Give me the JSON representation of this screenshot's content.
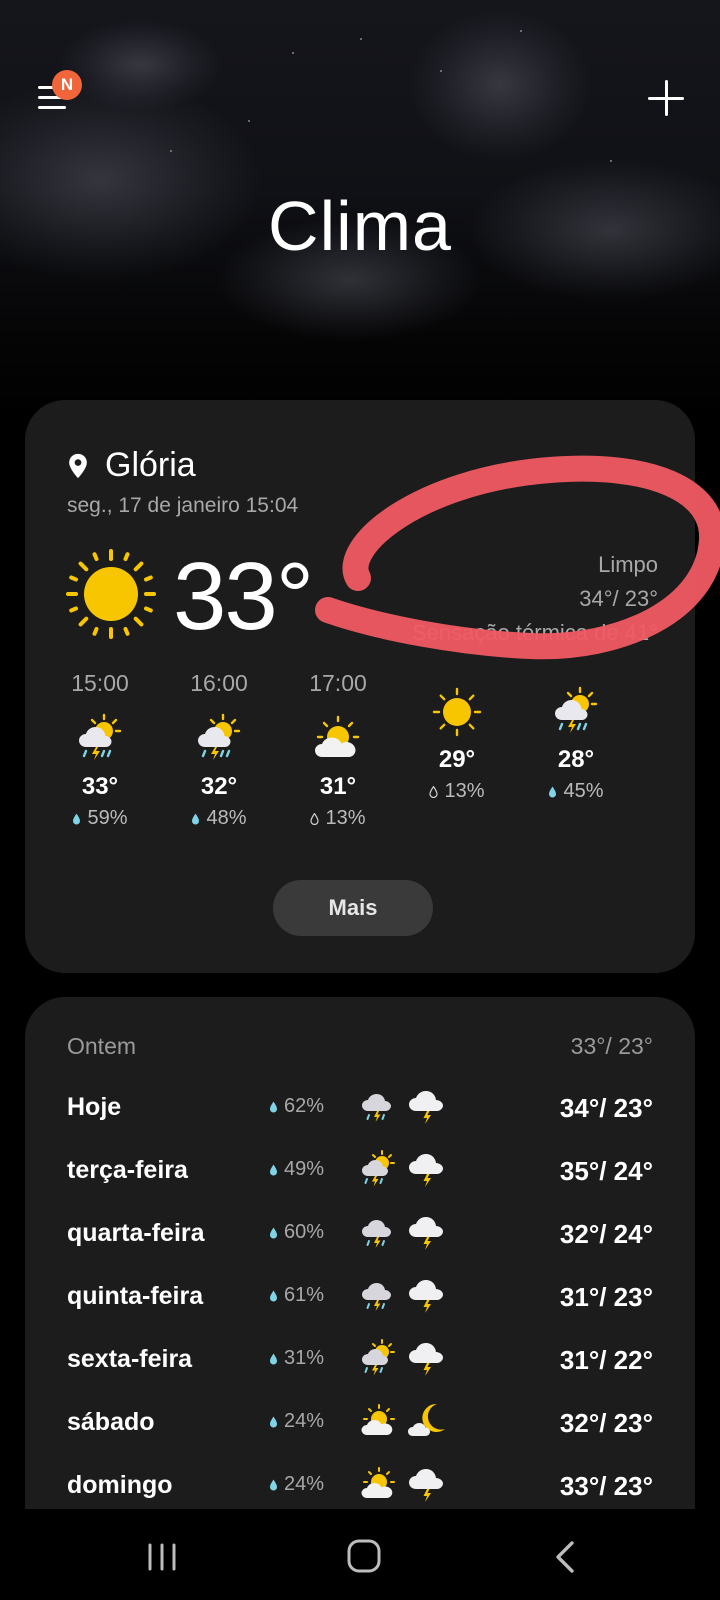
{
  "header": {
    "title": "Clima",
    "menu_badge": "N"
  },
  "current": {
    "location": "Glória",
    "datetime": "seg., 17 de janeiro 15:04",
    "temperature": "33°",
    "condition": "Limpo",
    "high_low": "34°/ 23°",
    "feels_like": "Sensação térmica de 41°",
    "icon": "sun-icon",
    "more_label": "Mais"
  },
  "hourly": [
    {
      "time": "15:00",
      "temp": "33°",
      "rain": "59%",
      "icon": "sun-thunder-rain-icon"
    },
    {
      "time": "16:00",
      "temp": "32°",
      "rain": "48%",
      "icon": "sun-thunder-rain-icon"
    },
    {
      "time": "17:00",
      "temp": "31°",
      "rain": "13%",
      "icon": "partly-cloudy-icon"
    },
    {
      "time": "",
      "temp": "29°",
      "rain": "13%",
      "icon": "sun-icon"
    },
    {
      "time": "",
      "temp": "28°",
      "rain": "45%",
      "icon": "sun-thunder-rain-icon"
    }
  ],
  "forecast": {
    "yesterday_label": "Ontem",
    "yesterday_temps": "33°/ 23°",
    "days": [
      {
        "day": "Hoje",
        "rain": "62%",
        "temps": "34°/ 23°",
        "icon_day": "cloud-thunder-rain-icon",
        "icon_night": "cloud-thunder-icon"
      },
      {
        "day": "terça-feira",
        "rain": "49%",
        "temps": "35°/ 24°",
        "icon_day": "sun-thunder-rain-icon",
        "icon_night": "cloud-thunder-icon"
      },
      {
        "day": "quarta-feira",
        "rain": "60%",
        "temps": "32°/ 24°",
        "icon_day": "cloud-thunder-rain-icon",
        "icon_night": "cloud-thunder-icon"
      },
      {
        "day": "quinta-feira",
        "rain": "61%",
        "temps": "31°/ 23°",
        "icon_day": "cloud-thunder-rain-icon",
        "icon_night": "cloud-thunder-icon"
      },
      {
        "day": "sexta-feira",
        "rain": "31%",
        "temps": "31°/ 22°",
        "icon_day": "sun-thunder-rain-icon",
        "icon_night": "cloud-thunder-icon"
      },
      {
        "day": "sábado",
        "rain": "24%",
        "temps": "32°/ 23°",
        "icon_day": "partly-cloudy-icon",
        "icon_night": "moon-cloud-icon"
      },
      {
        "day": "domingo",
        "rain": "24%",
        "temps": "33°/ 23°",
        "icon_day": "partly-cloudy-icon",
        "icon_night": "cloud-thunder-icon"
      }
    ]
  },
  "colors": {
    "sun": "#f7c600",
    "scribble": "#f05a63",
    "badge": "#f0663a",
    "rain_drop": "#7fd3e6"
  }
}
